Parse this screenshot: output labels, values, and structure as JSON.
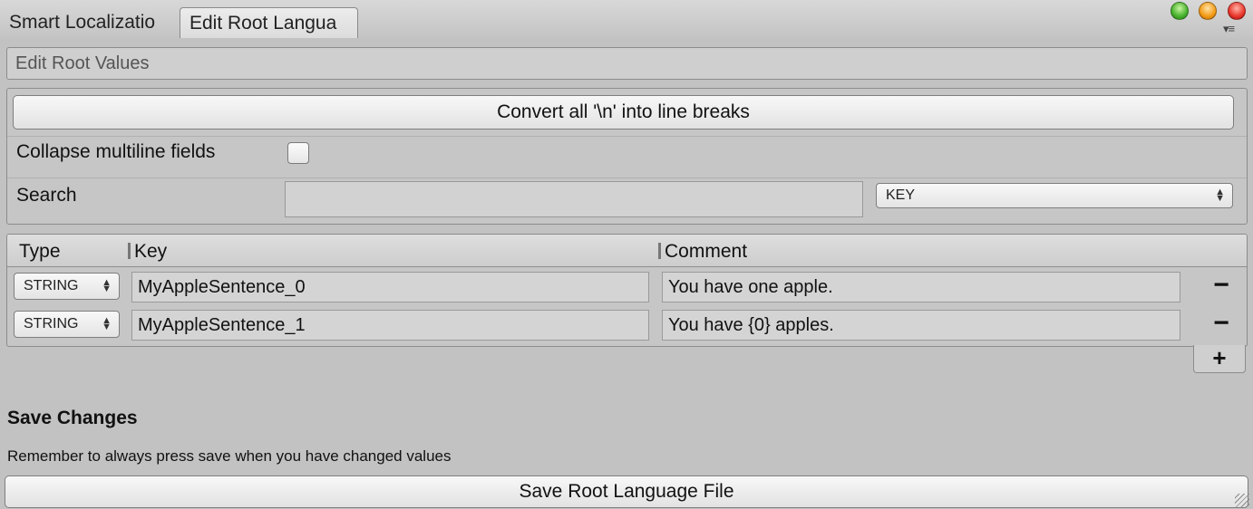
{
  "tabs": [
    {
      "label": "Smart Localizatio"
    },
    {
      "label": "Edit Root Langua"
    }
  ],
  "window_controls": {
    "menu_glyph": "▾≡"
  },
  "section_header": "Edit Root Values",
  "settings": {
    "convert_button_label": "Convert all '\\n' into line breaks",
    "collapse_label": "Collapse multiline fields",
    "collapse_checked": false,
    "search_label": "Search",
    "search_value": "",
    "search_mode": "KEY"
  },
  "table": {
    "columns": [
      "Type",
      "Key",
      "Comment"
    ],
    "rows": [
      {
        "type": "STRING",
        "key": "MyAppleSentence_0",
        "comment": "You have one apple."
      },
      {
        "type": "STRING",
        "key": "MyAppleSentence_1",
        "comment": "You have {0} apples."
      }
    ],
    "remove_glyph": "−",
    "add_glyph": "+"
  },
  "save": {
    "heading": "Save Changes",
    "note": "Remember to always press save when you have changed values",
    "button_label": "Save Root Language File"
  }
}
